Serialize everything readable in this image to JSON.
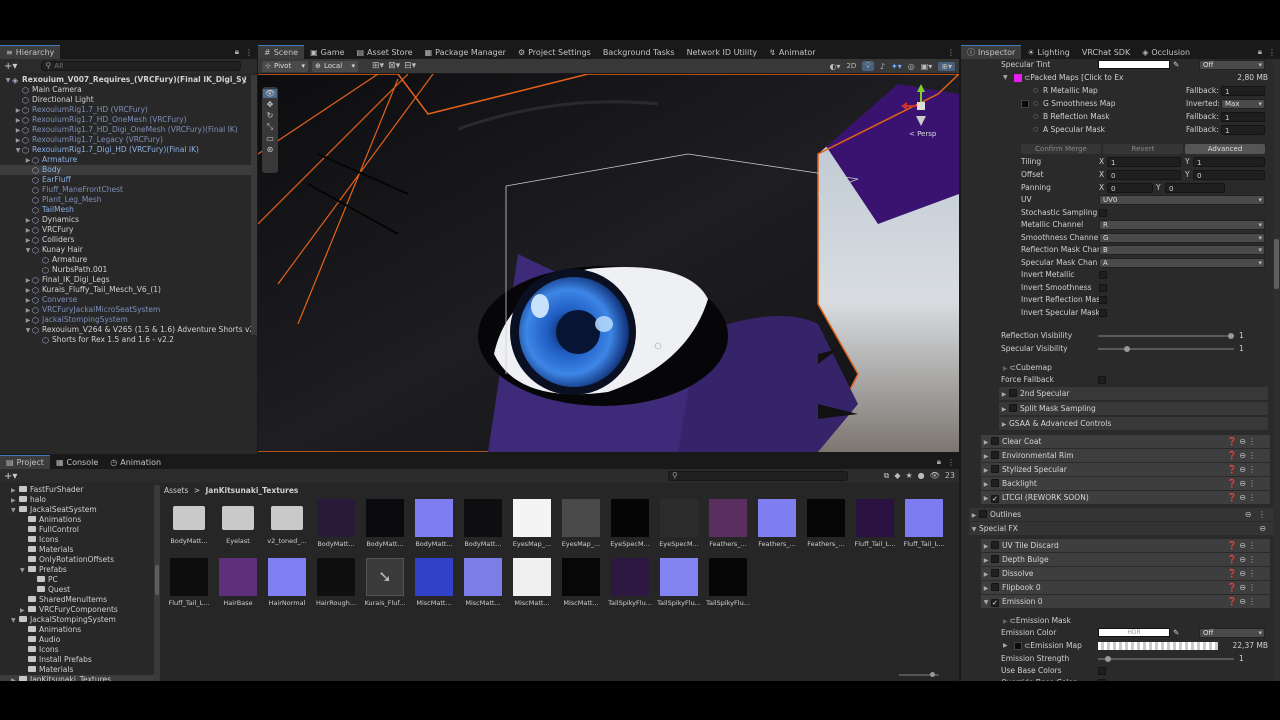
{
  "hierarchy": {
    "tab": "Hierarchy",
    "search_placeholder": "All",
    "rows": [
      {
        "label": "Rexouium_V007_Requires_(VRCFury)(Final IK_Digi_Sy",
        "indent": 0,
        "style": "bold",
        "fold": "▼"
      },
      {
        "label": "Main Camera",
        "indent": 1,
        "style": "",
        "fold": ""
      },
      {
        "label": "Directional Light",
        "indent": 1,
        "style": "",
        "fold": ""
      },
      {
        "label": "RexouiumRig1.7_HD (VRCFury)",
        "indent": 1,
        "style": "dim",
        "fold": "▶"
      },
      {
        "label": "RexouiumRig1.7_HD_OneMesh (VRCFury)",
        "indent": 1,
        "style": "dim",
        "fold": "▶"
      },
      {
        "label": "RexouiumRig1.7_HD_Digi_OneMesh (VRCFury)(Final IK)",
        "indent": 1,
        "style": "dim",
        "fold": "▶"
      },
      {
        "label": "RexouiumRig1.7_Legacy (VRCFury)",
        "indent": 1,
        "style": "dim",
        "fold": "▶"
      },
      {
        "label": "RexouiumRig1.7_Digi_HD (VRCFury)(Final IK)",
        "indent": 1,
        "style": "blue",
        "fold": "▼"
      },
      {
        "label": "Armature",
        "indent": 2,
        "style": "blue",
        "fold": "▶"
      },
      {
        "label": "Body",
        "indent": 2,
        "style": "blue sel",
        "fold": ""
      },
      {
        "label": "EarFluff",
        "indent": 2,
        "style": "blue",
        "fold": ""
      },
      {
        "label": "Fluff_ManeFrontChest",
        "indent": 2,
        "style": "dim",
        "fold": ""
      },
      {
        "label": "Plant_Leg_Mesh",
        "indent": 2,
        "style": "dim",
        "fold": ""
      },
      {
        "label": "TailMesh",
        "indent": 2,
        "style": "blue",
        "fold": ""
      },
      {
        "label": "Dynamics",
        "indent": 2,
        "style": "",
        "fold": "▶"
      },
      {
        "label": "VRCFury",
        "indent": 2,
        "style": "",
        "fold": "▶"
      },
      {
        "label": "Colliders",
        "indent": 2,
        "style": "",
        "fold": "▶"
      },
      {
        "label": "Kunay Hair",
        "indent": 2,
        "style": "",
        "fold": "▼"
      },
      {
        "label": "Armature",
        "indent": 3,
        "style": "",
        "fold": ""
      },
      {
        "label": "NurbsPath.001",
        "indent": 3,
        "style": "",
        "fold": ""
      },
      {
        "label": "Final_IK_Digi_Legs",
        "indent": 2,
        "style": "",
        "fold": "▶"
      },
      {
        "label": "Kurais_Fluffy_Tail_Mesch_V6_(1)",
        "indent": 2,
        "style": "",
        "fold": "▶"
      },
      {
        "label": "Converse",
        "indent": 2,
        "style": "dim",
        "fold": "▶"
      },
      {
        "label": "VRCFuryJackalMicroSeatSystem",
        "indent": 2,
        "style": "dim",
        "fold": "▶"
      },
      {
        "label": "JackalStompingSystem",
        "indent": 2,
        "style": "dim",
        "fold": "▶"
      },
      {
        "label": "Rexouium_V264 & V265 (1.5 & 1.6) Adventure Shorts v2.",
        "indent": 2,
        "style": "",
        "fold": "▼"
      },
      {
        "label": "Shorts for Rex 1.5 and 1.6 - v2.2",
        "indent": 3,
        "style": "",
        "fold": ""
      }
    ]
  },
  "scene": {
    "tabs": [
      {
        "label": "Scene",
        "icon": "#"
      },
      {
        "label": "Game",
        "icon": "▣"
      },
      {
        "label": "Asset Store",
        "icon": "▤"
      },
      {
        "label": "Package Manager",
        "icon": "▦"
      },
      {
        "label": "Project Settings",
        "icon": "⚙"
      },
      {
        "label": "Background Tasks",
        "icon": ""
      },
      {
        "label": "Network ID Utility",
        "icon": ""
      },
      {
        "label": "Animator",
        "icon": "↯"
      }
    ],
    "pivot": "Pivot",
    "local": "Local",
    "mode_2d": "2D",
    "gizmo_label": "< Persp"
  },
  "project": {
    "tabs": [
      "Project",
      "Console",
      "Animation"
    ],
    "breadcrumb_root": "Assets",
    "breadcrumb_sep": ">",
    "breadcrumb_current": "JanKitsunaki_Textures",
    "asset_count": "23",
    "folders": [
      {
        "label": "FastFurShader",
        "indent": 1,
        "fold": "▶"
      },
      {
        "label": "halo",
        "indent": 1,
        "fold": "▶"
      },
      {
        "label": "JackalSeatSystem",
        "indent": 1,
        "fold": "▼"
      },
      {
        "label": "Animations",
        "indent": 2,
        "fold": ""
      },
      {
        "label": "FullControl",
        "indent": 2,
        "fold": ""
      },
      {
        "label": "Icons",
        "indent": 2,
        "fold": ""
      },
      {
        "label": "Materials",
        "indent": 2,
        "fold": ""
      },
      {
        "label": "OnlyRotationOffsets",
        "indent": 2,
        "fold": ""
      },
      {
        "label": "Prefabs",
        "indent": 2,
        "fold": "▼"
      },
      {
        "label": "PC",
        "indent": 3,
        "fold": ""
      },
      {
        "label": "Quest",
        "indent": 3,
        "fold": ""
      },
      {
        "label": "SharedMenuItems",
        "indent": 2,
        "fold": ""
      },
      {
        "label": "VRCFuryComponents",
        "indent": 2,
        "fold": "▶"
      },
      {
        "label": "JackalStompingSystem",
        "indent": 1,
        "fold": "▼"
      },
      {
        "label": "Animations",
        "indent": 2,
        "fold": ""
      },
      {
        "label": "Audio",
        "indent": 2,
        "fold": ""
      },
      {
        "label": "Icons",
        "indent": 2,
        "fold": ""
      },
      {
        "label": "Install Prefabs",
        "indent": 2,
        "fold": ""
      },
      {
        "label": "Materials",
        "indent": 2,
        "fold": ""
      },
      {
        "label": "JanKitsunaki_Textures",
        "indent": 1,
        "fold": "▶"
      }
    ],
    "assets": [
      {
        "label": "BodyMatt...",
        "kind": "folder",
        "color": "#c9c9c9"
      },
      {
        "label": "Eyelast",
        "kind": "folder",
        "color": "#c9c9c9"
      },
      {
        "label": "v2_toned_...",
        "kind": "folder",
        "color": "#c9c9c9"
      },
      {
        "label": "BodyMatt...",
        "kind": "tex",
        "color": "#2a1a3a"
      },
      {
        "label": "BodyMatt...",
        "kind": "tex",
        "color": "#0b0b0f"
      },
      {
        "label": "BodyMatt...",
        "kind": "tex",
        "color": "#7e7ef0"
      },
      {
        "label": "BodyMatt...",
        "kind": "tex",
        "color": "#0e0e10"
      },
      {
        "label": "EyesMap_...",
        "kind": "tex",
        "color": "#f4f4f4"
      },
      {
        "label": "EyesMap_...",
        "kind": "tex",
        "color": "#4a4a4a"
      },
      {
        "label": "EyeSpecM...",
        "kind": "tex",
        "color": "#050505"
      },
      {
        "label": "EyeSpecM...",
        "kind": "tex",
        "color": "#2c2c2c"
      },
      {
        "label": "Feathers_...",
        "kind": "tex",
        "color": "#5a2f5f"
      },
      {
        "label": "Feathers_...",
        "kind": "tex",
        "color": "#7f7ff2"
      },
      {
        "label": "Feathers_...",
        "kind": "tex",
        "color": "#060606"
      },
      {
        "label": "Fluff_Tail_L...",
        "kind": "tex",
        "color": "#2a1240"
      },
      {
        "label": "Fluff_Tail_L...",
        "kind": "tex",
        "color": "#7c7cf0"
      },
      {
        "label": "Fluff_Tail_L...",
        "kind": "tex",
        "color": "#0c0c0c"
      },
      {
        "label": "HairBase",
        "kind": "tex",
        "color": "#5e2f7a"
      },
      {
        "label": "HairNormal",
        "kind": "tex",
        "color": "#8080f4"
      },
      {
        "label": "HairRough...",
        "kind": "tex",
        "color": "#0f0f0f"
      },
      {
        "label": "Kurais_Fluf...",
        "kind": "mesh",
        "color": "#3a3a3a"
      },
      {
        "label": "MiscMatt...",
        "kind": "tex",
        "color": "#3242c8"
      },
      {
        "label": "MiscMatt...",
        "kind": "tex",
        "color": "#7d7de8"
      },
      {
        "label": "MiscMatt...",
        "kind": "tex",
        "color": "#f0f0f0"
      },
      {
        "label": "MiscMatt...",
        "kind": "tex",
        "color": "#070707"
      },
      {
        "label": "TailSpikyFlu...",
        "kind": "tex",
        "color": "#2c1840"
      },
      {
        "label": "TailSpikyFlu...",
        "kind": "tex",
        "color": "#8383f2"
      },
      {
        "label": "TailSpikyFlu...",
        "kind": "tex",
        "color": "#060606"
      }
    ]
  },
  "inspector": {
    "tabs": [
      {
        "label": "Inspector",
        "icon": "ⓘ"
      },
      {
        "label": "Lighting",
        "icon": "☀"
      },
      {
        "label": "VRChat SDK",
        "icon": ""
      },
      {
        "label": "Occlusion",
        "icon": "◈"
      }
    ],
    "specular_tint_label": "Specular Tint",
    "specular_tint_mode": "Off",
    "packed_maps_label": "Packed Maps [Click to Ex",
    "packed_maps_size": "2,80 MB",
    "maps": [
      {
        "label": "R Metallic Map",
        "right_label": "Fallback:",
        "right_value": "1"
      },
      {
        "label": "G Smoothness Map",
        "right_label": "Inverted:",
        "right_value": "Max"
      },
      {
        "label": "B Reflection Mask",
        "right_label": "Fallback:",
        "right_value": "1"
      },
      {
        "label": "A Specular Mask",
        "right_label": "Fallback:",
        "right_value": "1"
      }
    ],
    "confirm_merge": "Confirm Merge",
    "revert": "Revert",
    "advanced": "Advanced",
    "tiling": {
      "label": "Tiling",
      "x": "1",
      "y": "1"
    },
    "offset": {
      "label": "Offset",
      "x": "0",
      "y": "0"
    },
    "panning": {
      "label": "Panning",
      "x": "0",
      "y": "0"
    },
    "uv": {
      "label": "UV",
      "value": "UV0"
    },
    "stochastic": "Stochastic Sampling",
    "channels": [
      {
        "label": "Metallic Channel",
        "value": "R"
      },
      {
        "label": "Smoothness Channel",
        "value": "G"
      },
      {
        "label": "Reflection Mask Char",
        "value": "B"
      },
      {
        "label": "Specular Mask Chan",
        "value": "A"
      }
    ],
    "inverts": [
      "Invert Metallic",
      "Invert Smoothness",
      "Invert Reflection Mas",
      "Invert Specular Mask"
    ],
    "reflection_visibility": {
      "label": "Reflection Visibility",
      "value": "1",
      "fraction": 1.0
    },
    "specular_visibility": {
      "label": "Specular Visibility",
      "value": "1",
      "fraction": 0.2
    },
    "cubemap": "Cubemap",
    "force_fallback": "Force Fallback",
    "sub_sections": [
      "2nd Specular",
      "Split Mask Sampling",
      "GSAA & Advanced Controls"
    ],
    "sections": [
      {
        "label": "Clear Coat",
        "checked": false
      },
      {
        "label": "Environmental Rim",
        "checked": false
      },
      {
        "label": "Stylized Specular",
        "checked": false
      },
      {
        "label": "Backlight",
        "checked": false
      },
      {
        "label": "LTCGI (REWORK SOON)",
        "checked": true
      }
    ],
    "outlines": "Outlines",
    "special_fx": "Special FX",
    "fx_sections": [
      {
        "label": "UV Tile Discard",
        "checked": false
      },
      {
        "label": "Depth Bulge",
        "checked": false
      },
      {
        "label": "Dissolve",
        "checked": false
      },
      {
        "label": "Flipbook 0",
        "checked": false
      },
      {
        "label": "Emission 0",
        "checked": true
      }
    ],
    "emission_mask": "Emission Mask",
    "emission_color": {
      "label": "Emission Color",
      "hdr": "HDR",
      "mode": "Off"
    },
    "emission_map": {
      "label": "Emission Map",
      "size": "22,37 MB"
    },
    "emission_strength": {
      "label": "Emission Strength",
      "value": "1",
      "fraction": 0.05
    },
    "use_base_colors": "Use Base Colors",
    "override_base_color": "Override Base Color"
  }
}
